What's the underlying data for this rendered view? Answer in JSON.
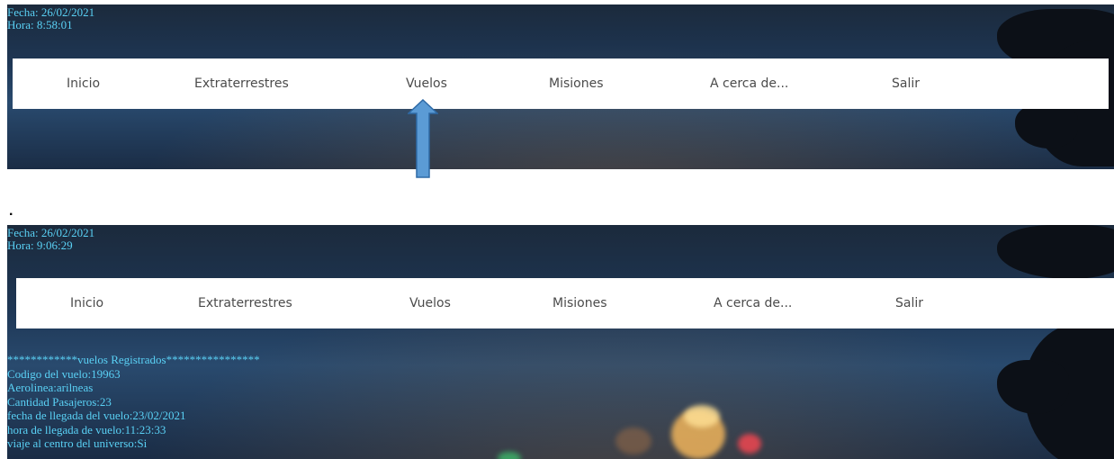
{
  "top_panel": {
    "fecha": "Fecha: 26/02/2021",
    "hora": "Hora: 8:58:01"
  },
  "bottom_panel": {
    "fecha": "Fecha: 26/02/2021",
    "hora": "Hora: 9:06:29"
  },
  "nav": {
    "items": [
      "Inicio",
      "Extraterrestres",
      "Vuelos",
      "Misiones",
      "A cerca de...",
      "Salir"
    ]
  },
  "separator": ".",
  "flights": {
    "header": "************vuelos Registrados****************",
    "codigo": "Codigo del vuelo:19963",
    "aerolinea": "Aerolinea:arilneas",
    "pasajeros": "Cantidad Pasajeros:23",
    "fecha_llegada": "fecha de llegada del vuelo:23/02/2021",
    "hora_llegada": "hora de llegada de vuelo:11:23:33",
    "viaje": "viaje al centro del universo:Si"
  },
  "colors": {
    "info_text": "#5ad1f5",
    "arrow_fill": "#5b9bd5",
    "arrow_stroke": "#2e6aa6"
  }
}
